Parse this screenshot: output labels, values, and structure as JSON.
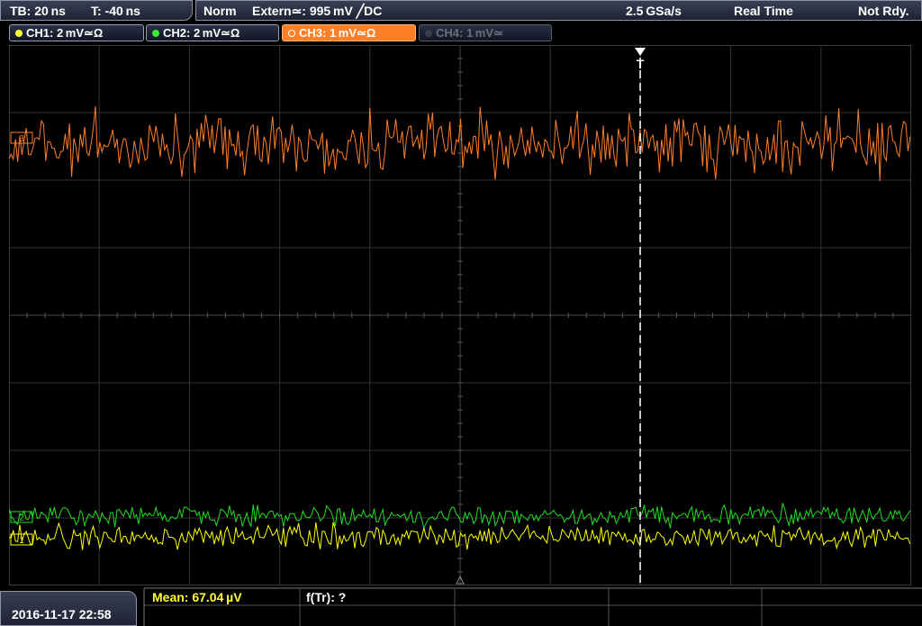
{
  "status_bar": {
    "timebase": "TB: 20 ns",
    "trigger_time": "T: -40 ns",
    "trigger_mode": "Norm",
    "trigger_source": "Extern≃: 995 mV ╱DC",
    "sample_rate": "2.5 GSa/s",
    "acq_mode": "Real Time",
    "state": "Not Rdy."
  },
  "channels": [
    {
      "label": "CH1: 2 mV≃Ω",
      "color": "#ffff33",
      "active": false,
      "enabled": true
    },
    {
      "label": "CH2: 2 mV≃Ω",
      "color": "#33ee33",
      "active": false,
      "enabled": true
    },
    {
      "label": "CH3: 1 mV≃Ω",
      "color": "#ff7f27",
      "active": true,
      "enabled": true
    },
    {
      "label": "CH4: 1 mV≃",
      "color": "#6b6f7d",
      "active": false,
      "enabled": false
    }
  ],
  "trigger_marker": "T",
  "markers": {
    "ch3": "3",
    "ch2": "2",
    "ch1": "1"
  },
  "measurements": {
    "mean": "Mean: 67.04 µV",
    "freq": "f(Tr): ?"
  },
  "datetime": "2016-11-17 22:58",
  "colors": {
    "ch1": "#ffff00",
    "ch2": "#22dd22",
    "ch3": "#ff7f27",
    "grid": "#3a3a3a",
    "meas_text": "#ffff33"
  }
}
